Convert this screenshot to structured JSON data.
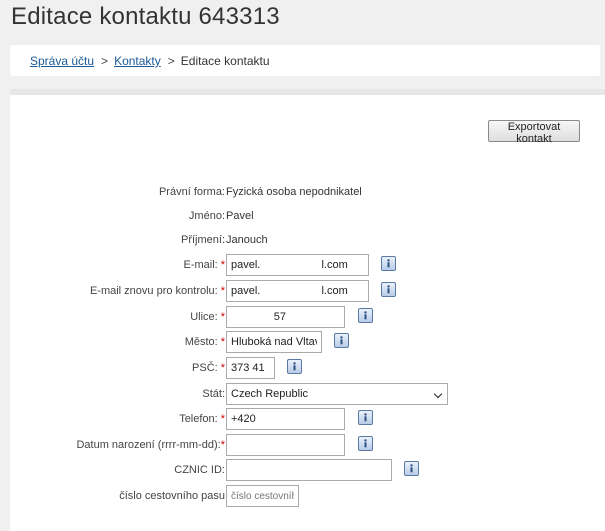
{
  "page": {
    "title": "Editace kontaktu 643313"
  },
  "breadcrumb": {
    "items": [
      {
        "label": "Správa účtu"
      },
      {
        "label": "Kontakty"
      },
      {
        "label": "Editace kontaktu"
      }
    ],
    "separator": ">"
  },
  "toolbar": {
    "export_label": "Exportovat kontakt"
  },
  "form": {
    "legal_form": {
      "label": "Právní forma:",
      "value": "Fyzická osoba nepodnikatel"
    },
    "first_name": {
      "label": "Jméno:",
      "value": "Pavel"
    },
    "last_name": {
      "label": "Příjmení:",
      "value": "Janouch"
    },
    "email": {
      "label": "E-mail:",
      "required": "*",
      "value": "pavel.                    l.com"
    },
    "email_confirm": {
      "label": "E-mail znovu pro kontrolu:",
      "required": "*",
      "value": "pavel.                    l.com"
    },
    "street": {
      "label": "Ulice:",
      "required": "*",
      "value": "              57"
    },
    "city": {
      "label": "Město:",
      "required": "*",
      "value": "Hluboká nad Vltavou"
    },
    "zip": {
      "label": "PSČ:",
      "required": "*",
      "value": "373 41"
    },
    "country": {
      "label": "Stát:",
      "selected": "Czech Republic"
    },
    "phone": {
      "label": "Telefon:",
      "required": "*",
      "value": "+420"
    },
    "birth_date": {
      "label": "Datum narození (rrrr-mm-dd):",
      "required": "*",
      "value": ""
    },
    "cznic_id": {
      "label": "CZNIC ID:",
      "value": ""
    },
    "passport": {
      "label": "číslo cestovního pasu",
      "value": "",
      "placeholder": "číslo cestovního"
    }
  },
  "colors": {
    "link": "#1a5a96",
    "required": "#d20000",
    "info_icon": "#5b7aa3"
  },
  "icons": {
    "info": "info-icon",
    "dropdown": "chevron-down-icon"
  }
}
